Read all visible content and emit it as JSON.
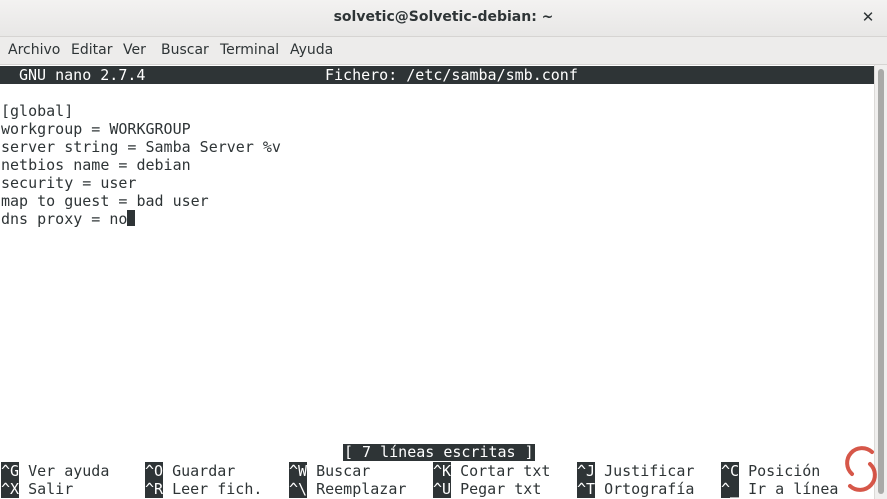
{
  "window": {
    "title": "solvetic@Solvetic-debian: ~",
    "close_glyph": "✕"
  },
  "menu": [
    "Archivo",
    "Editar",
    "Ver",
    "Buscar",
    "Terminal",
    "Ayuda"
  ],
  "nano": {
    "version": "GNU nano 2.7.4",
    "file": "Fichero: /etc/samba/smb.conf",
    "lines": [
      "[global]",
      "workgroup = WORKGROUP",
      "server string = Samba Server %v",
      "netbios name = debian",
      "security = user",
      "map to guest = bad user",
      "dns proxy = no"
    ],
    "status": "[ 7 líneas escritas ]",
    "shortcuts": [
      {
        "key": "^G",
        "label": "Ver ayuda"
      },
      {
        "key": "^O",
        "label": "Guardar"
      },
      {
        "key": "^W",
        "label": "Buscar"
      },
      {
        "key": "^K",
        "label": "Cortar txt"
      },
      {
        "key": "^J",
        "label": "Justificar"
      },
      {
        "key": "^C",
        "label": "Posición"
      },
      {
        "key": "^X",
        "label": "Salir"
      },
      {
        "key": "^R",
        "label": "Leer fich."
      },
      {
        "key": "^\\",
        "label": "Reemplazar"
      },
      {
        "key": "^U",
        "label": "Pegar txt"
      },
      {
        "key": "^T",
        "label": "Ortografía"
      },
      {
        "key": "^_",
        "label": "Ir a línea"
      }
    ]
  },
  "colors": {
    "terminal_fg": "#2e3436",
    "terminal_bg": "#ffffff",
    "watermark": "#d03a2a"
  },
  "icons": {
    "close": "close-icon",
    "watermark": "solvetic-logo-icon"
  }
}
